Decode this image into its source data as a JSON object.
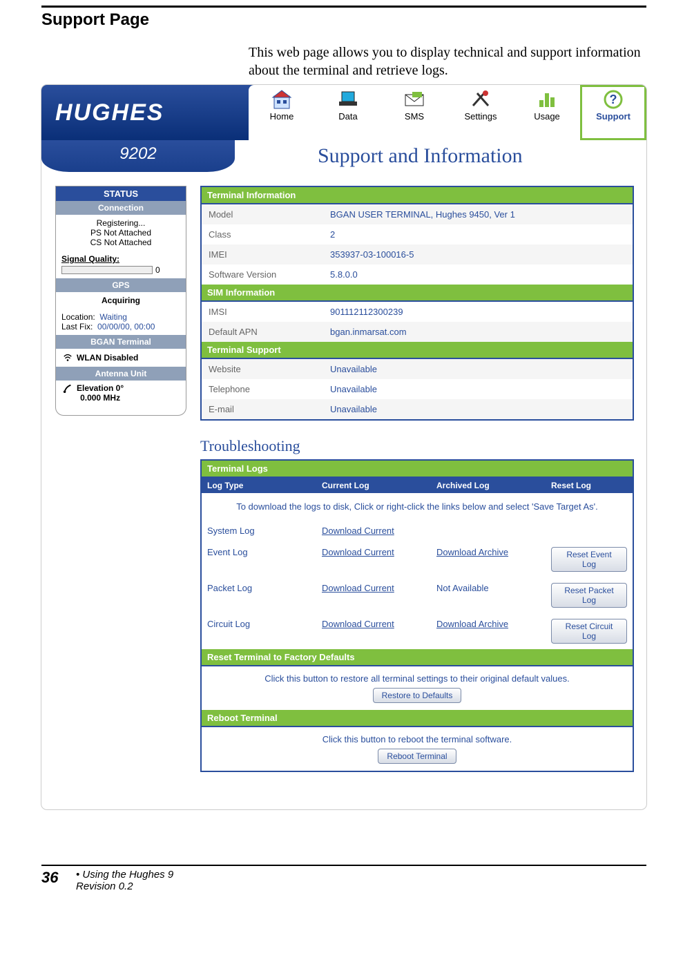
{
  "doc": {
    "section_title": "Support Page",
    "intro": "This web page allows you to display technical and support information about the terminal and retrieve logs.",
    "page_number": "36",
    "footer_line1": "• Using the Hughes 9",
    "footer_line2": "Revision 0.2"
  },
  "app": {
    "brand": "HUGHES",
    "model": "9202",
    "page_heading": "Support and Information",
    "nav": {
      "home": "Home",
      "data": "Data",
      "sms": "SMS",
      "settings": "Settings",
      "usage": "Usage",
      "support": "Support"
    },
    "status": {
      "panel_title": "STATUS",
      "connection": {
        "title": "Connection",
        "line1": "Registering...",
        "line2": "PS Not Attached",
        "line3": "CS Not Attached",
        "signal_label": "Signal Quality:",
        "signal_value": "0"
      },
      "gps": {
        "title": "GPS",
        "line1": "Acquiring",
        "loc_label": "Location:",
        "loc_value": "Waiting",
        "fix_label": "Last Fix:",
        "fix_value": "00/00/00, 00:00"
      },
      "bgan": {
        "title": "BGAN Terminal",
        "wlan": "WLAN Disabled"
      },
      "antenna": {
        "title": "Antenna Unit",
        "line1": "Elevation 0°",
        "line2": "0.000 MHz"
      }
    },
    "terminal_info": {
      "title": "Terminal Information",
      "rows": {
        "model_k": "Model",
        "model_v": "BGAN USER TERMINAL, Hughes 9450, Ver 1",
        "class_k": "Class",
        "class_v": "2",
        "imei_k": "IMEI",
        "imei_v": "353937-03-100016-5",
        "sw_k": "Software Version",
        "sw_v": "5.8.0.0"
      }
    },
    "sim_info": {
      "title": "SIM Information",
      "rows": {
        "imsi_k": "IMSI",
        "imsi_v": "901112112300239",
        "apn_k": "Default APN",
        "apn_v": "bgan.inmarsat.com"
      }
    },
    "support": {
      "title": "Terminal Support",
      "rows": {
        "web_k": "Website",
        "web_v": "Unavailable",
        "tel_k": "Telephone",
        "tel_v": "Unavailable",
        "mail_k": "E-mail",
        "mail_v": "Unavailable"
      }
    },
    "trouble": {
      "heading": "Troubleshooting",
      "logs": {
        "title": "Terminal Logs",
        "hdr": {
          "c1": "Log Type",
          "c2": "Current Log",
          "c3": "Archived Log",
          "c4": "Reset Log"
        },
        "note": "To download the logs to disk, Click or right-click the links below and select 'Save Target As'.",
        "system": {
          "name": "System Log",
          "cur": "Download Current",
          "arc": "",
          "reset": ""
        },
        "event": {
          "name": "Event Log",
          "cur": "Download Current",
          "arc": "Download Archive",
          "reset": "Reset Event Log"
        },
        "packet": {
          "name": "Packet Log",
          "cur": "Download Current",
          "arc": "Not Available",
          "reset": "Reset Packet Log"
        },
        "circuit": {
          "name": "Circuit Log",
          "cur": "Download Current",
          "arc": "Download Archive",
          "reset": "Reset Circuit Log"
        }
      },
      "reset": {
        "title": "Reset Terminal to Factory Defaults",
        "note": "Click this button to restore all terminal settings to their original default values.",
        "btn": "Restore to Defaults"
      },
      "reboot": {
        "title": "Reboot Terminal",
        "note": "Click this button to reboot the terminal software.",
        "btn": "Reboot Terminal"
      }
    }
  }
}
